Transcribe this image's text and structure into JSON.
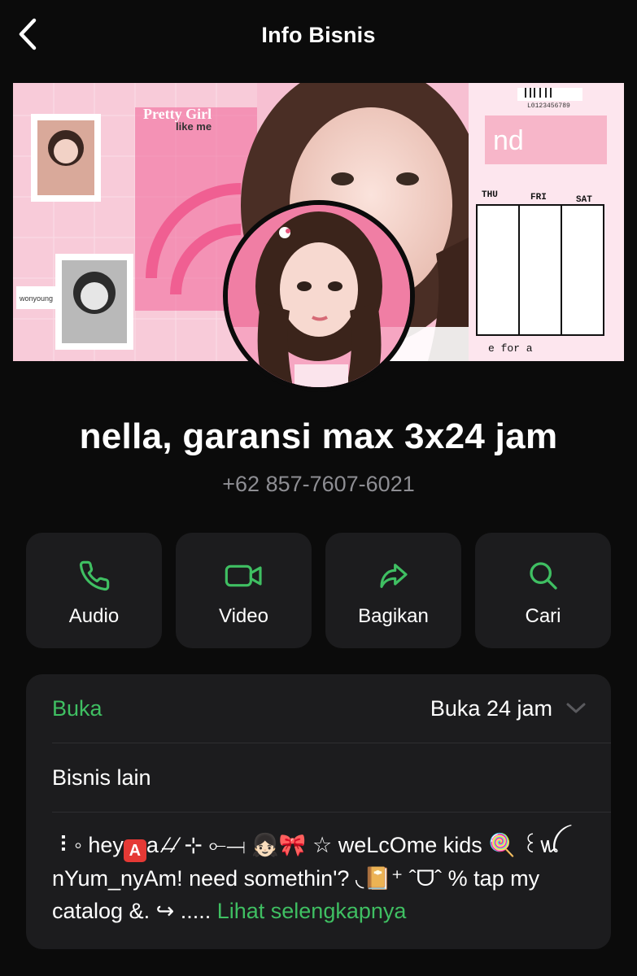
{
  "header": {
    "title": "Info Bisnis"
  },
  "profile": {
    "name": "nella, garansi max 3x24 jam",
    "phone": "+62 857-7607-6021"
  },
  "cover_texts": {
    "pretty": "Pretty Girl",
    "like": "like me",
    "barcode": "L0123456789",
    "thu": "THU",
    "fri": "FRI",
    "sat": "SAT",
    "for": "e  for  a",
    "sticker": "wonyoung"
  },
  "actions": [
    {
      "label": "Audio",
      "icon": "phone-icon"
    },
    {
      "label": "Video",
      "icon": "video-icon"
    },
    {
      "label": "Bagikan",
      "icon": "share-icon"
    },
    {
      "label": "Cari",
      "icon": "search-icon"
    }
  ],
  "hours": {
    "status": "Buka",
    "value": "Buka 24 jam"
  },
  "other_business": "Bisnis lain",
  "description": {
    "part1": "⠸ ◦ hey",
    "badge": "A",
    "part2": "a ⁄̶ ⁄ ⊹ ⟜⟞  👧🏻🎀  ☆ weLcOme kids 🍭 ꒰ꪡ nYum_nyAm! need somethin'? ◟📔⁺ ˆᗜˆ % tap my catalog &. ↪ ..... ",
    "more": "Lihat selengkapnya"
  },
  "colors": {
    "accent": "#3fbf62",
    "background": "#0b0b0b",
    "card": "#1c1c1e",
    "muted": "#8e8e93"
  }
}
